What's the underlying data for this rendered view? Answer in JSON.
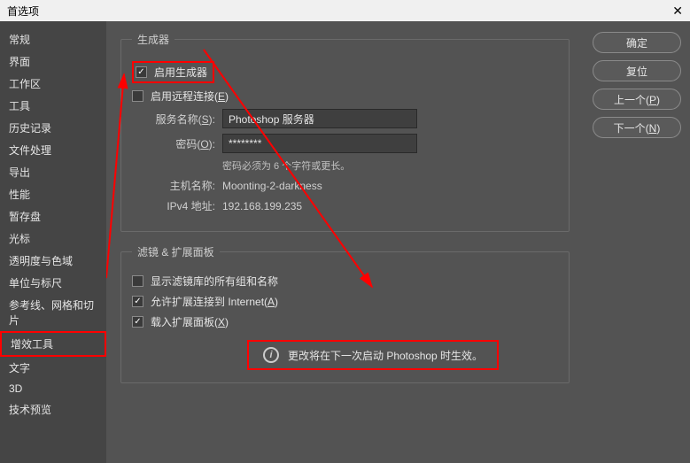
{
  "titlebar": {
    "title": "首选项"
  },
  "sidebar": {
    "items": [
      {
        "label": "常规"
      },
      {
        "label": "界面"
      },
      {
        "label": "工作区"
      },
      {
        "label": "工具"
      },
      {
        "label": "历史记录"
      },
      {
        "label": "文件处理"
      },
      {
        "label": "导出"
      },
      {
        "label": "性能"
      },
      {
        "label": "暂存盘"
      },
      {
        "label": "光标"
      },
      {
        "label": "透明度与色域"
      },
      {
        "label": "单位与标尺"
      },
      {
        "label": "参考线、网格和切片"
      },
      {
        "label": "增效工具"
      },
      {
        "label": "文字"
      },
      {
        "label": "3D"
      },
      {
        "label": "技术预览"
      }
    ]
  },
  "generator": {
    "legend": "生成器",
    "enable_label": "启用生成器",
    "remote_label_pre": "启用远程连接(",
    "remote_key": "E",
    "remote_label_post": ")",
    "service_label_pre": "服务名称(",
    "service_key": "S",
    "service_label_post": "):",
    "service_value": "Photoshop 服务器",
    "password_label_pre": "密码(",
    "password_key": "O",
    "password_label_post": "):",
    "password_value": "********",
    "password_hint": "密码必须为 6 个字符或更长。",
    "host_label": "主机名称:",
    "host_value": "Moonting-2-darkness",
    "ip_label": "IPv4 地址:",
    "ip_value": "192.168.199.235"
  },
  "filters": {
    "legend": "滤镜 & 扩展面板",
    "show_all_label": "显示滤镜库的所有组和名称",
    "allow_ext_pre": "允许扩展连接到 Internet(",
    "allow_ext_key": "A",
    "allow_ext_post": ")",
    "load_ext_pre": "载入扩展面板(",
    "load_ext_key": "X",
    "load_ext_post": ")",
    "notice": "更改将在下一次启动 Photoshop 时生效。"
  },
  "buttons": {
    "ok": "确定",
    "reset": "复位",
    "prev_pre": "上一个(",
    "prev_key": "P",
    "prev_post": ")",
    "next_pre": "下一个(",
    "next_key": "N",
    "next_post": ")"
  }
}
